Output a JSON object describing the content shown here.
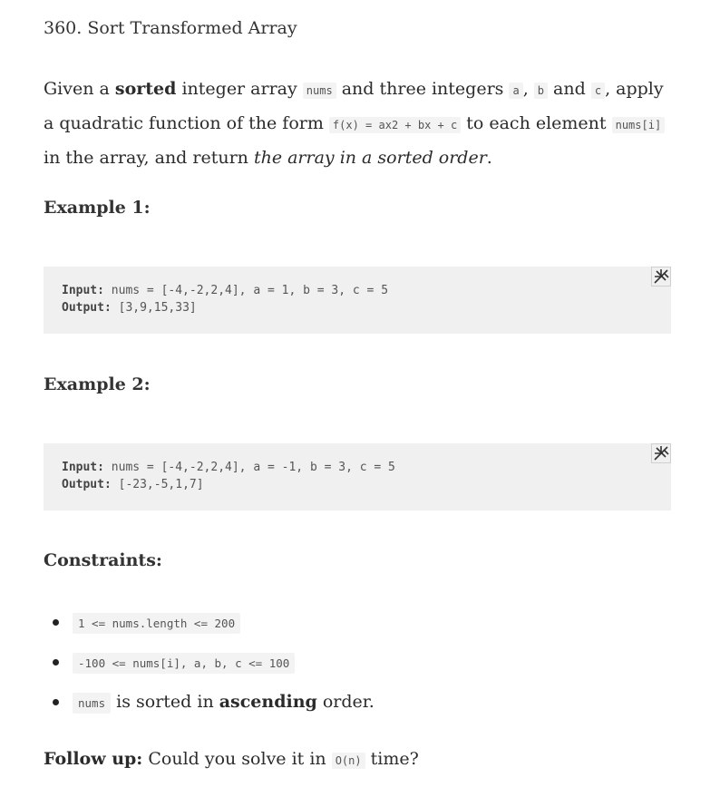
{
  "title": "360. Sort Transformed Array",
  "description": {
    "s1": "Given a ",
    "sorted": "sorted",
    "s2": " integer array ",
    "nums": "nums",
    "s3": " and three integers ",
    "a": "a",
    "comma": ", ",
    "b": "b",
    "and": " and ",
    "c": "c",
    "s4": ", apply a quadratic function of the form ",
    "fx": "f(x)",
    "formula_tail": " = ax2 + bx + c",
    "s5": " to each element ",
    "numsi": "nums[i]",
    "s6": " in the array, and return ",
    "italic": "the array in a sorted order",
    "end": "."
  },
  "examples": [
    {
      "heading": "Example 1:",
      "input_label": "Input:",
      "input_value": " nums = [-4,-2,2,4], a = 1, b = 3, c = 5",
      "output_label": "Output:",
      "output_value": " [3,9,15,33]"
    },
    {
      "heading": "Example 2:",
      "input_label": "Input:",
      "input_value": " nums = [-4,-2,2,4], a = -1, b = 3, c = 5",
      "output_label": "Output:",
      "output_value": " [-23,-5,1,7]"
    }
  ],
  "copy_icon": "copy-icon",
  "constraints": {
    "heading": "Constraints:",
    "items": [
      "1 <= nums.length <= 200",
      "-100 <= nums[i], a, b, c <= 100"
    ],
    "third": {
      "code": "nums",
      "t1": " is sorted in ",
      "bold": "ascending",
      "t2": " order."
    }
  },
  "followup": {
    "label": "Follow up:",
    "t1": " Could you solve it in ",
    "code": "O(n)",
    "t2": " time?"
  }
}
